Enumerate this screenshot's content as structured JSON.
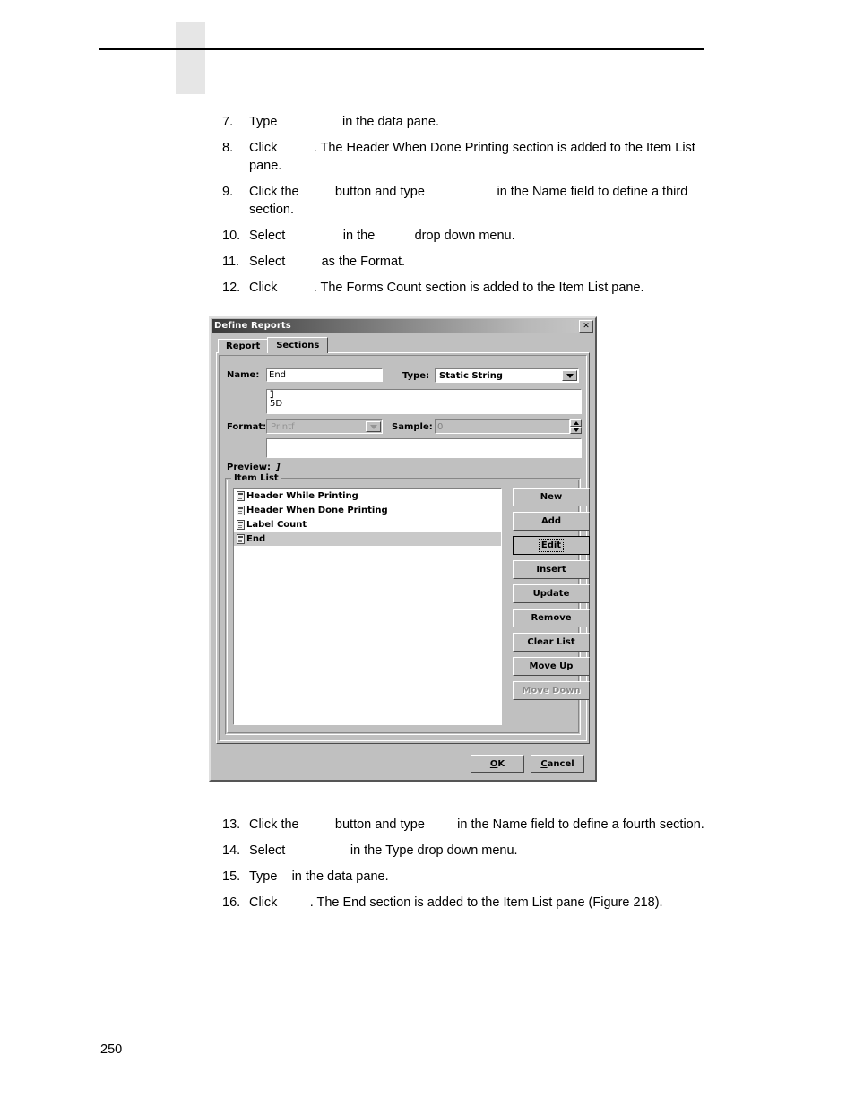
{
  "page": {
    "number": "250",
    "header_rule": true
  },
  "steps_top": [
    {
      "num": "7.",
      "parts": [
        {
          "t": "text",
          "v": "Type"
        },
        {
          "t": "blank",
          "v": "                "
        },
        {
          "t": "text",
          "v": "in the data pane."
        }
      ]
    },
    {
      "num": "8.",
      "parts": [
        {
          "t": "text",
          "v": "Click"
        },
        {
          "t": "blank",
          "v": "        "
        },
        {
          "t": "text",
          "v": ". The Header When Done Printing section is added to the Item List pane."
        }
      ]
    },
    {
      "num": "9.",
      "parts": [
        {
          "t": "text",
          "v": "Click the"
        },
        {
          "t": "blank",
          "v": "        "
        },
        {
          "t": "text",
          "v": "button and type"
        },
        {
          "t": "blank",
          "v": "                  "
        },
        {
          "t": "text",
          "v": "in the Name field to define a third section."
        }
      ]
    },
    {
      "num": "10.",
      "parts": [
        {
          "t": "text",
          "v": "Select"
        },
        {
          "t": "blank",
          "v": "              "
        },
        {
          "t": "text",
          "v": "in the"
        },
        {
          "t": "blank",
          "v": "         "
        },
        {
          "t": "text",
          "v": "drop down menu."
        }
      ]
    },
    {
      "num": "11.",
      "parts": [
        {
          "t": "text",
          "v": "Select"
        },
        {
          "t": "blank",
          "v": "        "
        },
        {
          "t": "text",
          "v": "as the Format."
        }
      ]
    },
    {
      "num": "12.",
      "parts": [
        {
          "t": "text",
          "v": "Click"
        },
        {
          "t": "blank",
          "v": "        "
        },
        {
          "t": "text",
          "v": ". The Forms Count section is added to the Item List pane."
        }
      ]
    }
  ],
  "steps_bottom": [
    {
      "num": "13.",
      "parts": [
        {
          "t": "text",
          "v": "Click the"
        },
        {
          "t": "blank",
          "v": "        "
        },
        {
          "t": "text",
          "v": "button and type"
        },
        {
          "t": "blank",
          "v": "       "
        },
        {
          "t": "text",
          "v": "in the Name field to define a fourth section."
        }
      ]
    },
    {
      "num": "14.",
      "parts": [
        {
          "t": "text",
          "v": "Select"
        },
        {
          "t": "blank",
          "v": "                "
        },
        {
          "t": "text",
          "v": "in the Type drop down menu."
        }
      ]
    },
    {
      "num": "15.",
      "parts": [
        {
          "t": "text",
          "v": "Type"
        },
        {
          "t": "blank",
          "v": "  "
        },
        {
          "t": "text",
          "v": "in the data pane."
        }
      ]
    },
    {
      "num": "16.",
      "parts": [
        {
          "t": "text",
          "v": "Click"
        },
        {
          "t": "blank",
          "v": "       "
        },
        {
          "t": "text",
          "v": ". The End section is added to the Item List pane (Figure 218)."
        }
      ]
    }
  ],
  "dialog": {
    "title": "Define Reports",
    "close_label": "✕",
    "tabs": [
      {
        "label": "Report",
        "active": false
      },
      {
        "label": "Sections",
        "active": true
      }
    ],
    "name_label": "Name:",
    "name_value": "End",
    "type_label": "Type:",
    "type_value": "Static String",
    "data_pane": {
      "line1": "]",
      "line2": "5D"
    },
    "format_label": "Format:",
    "format_value": "Printf",
    "format_disabled": true,
    "sample_label": "Sample:",
    "sample_value": "0",
    "sample_disabled": true,
    "extra_pane_value": "",
    "preview_label": "Preview:",
    "preview_value": "]",
    "item_list": {
      "title": "Item List",
      "items": [
        {
          "label": "Header While Printing",
          "selected": false
        },
        {
          "label": "Header When Done Printing",
          "selected": false
        },
        {
          "label": "Label Count",
          "selected": false
        },
        {
          "label": "End",
          "selected": true
        }
      ],
      "buttons": [
        {
          "label": "New",
          "state": "normal"
        },
        {
          "label": "Add",
          "state": "normal"
        },
        {
          "label": "Edit",
          "state": "focused"
        },
        {
          "label": "Insert",
          "state": "normal"
        },
        {
          "label": "Update",
          "state": "normal"
        },
        {
          "label": "Remove",
          "state": "normal"
        },
        {
          "label": "Clear List",
          "state": "normal"
        },
        {
          "label": "Move Up",
          "state": "normal"
        },
        {
          "label": "Move Down",
          "state": "disabled"
        }
      ]
    },
    "ok_label": "OK",
    "ok_mnemonic": "O",
    "cancel_label": "Cancel",
    "cancel_mnemonic": "C"
  },
  "colors": {
    "dialog_face": "#c0c0c0",
    "selection": "#c9c9c9",
    "header_tab": "#e6e6e6",
    "rule": "#000000"
  }
}
